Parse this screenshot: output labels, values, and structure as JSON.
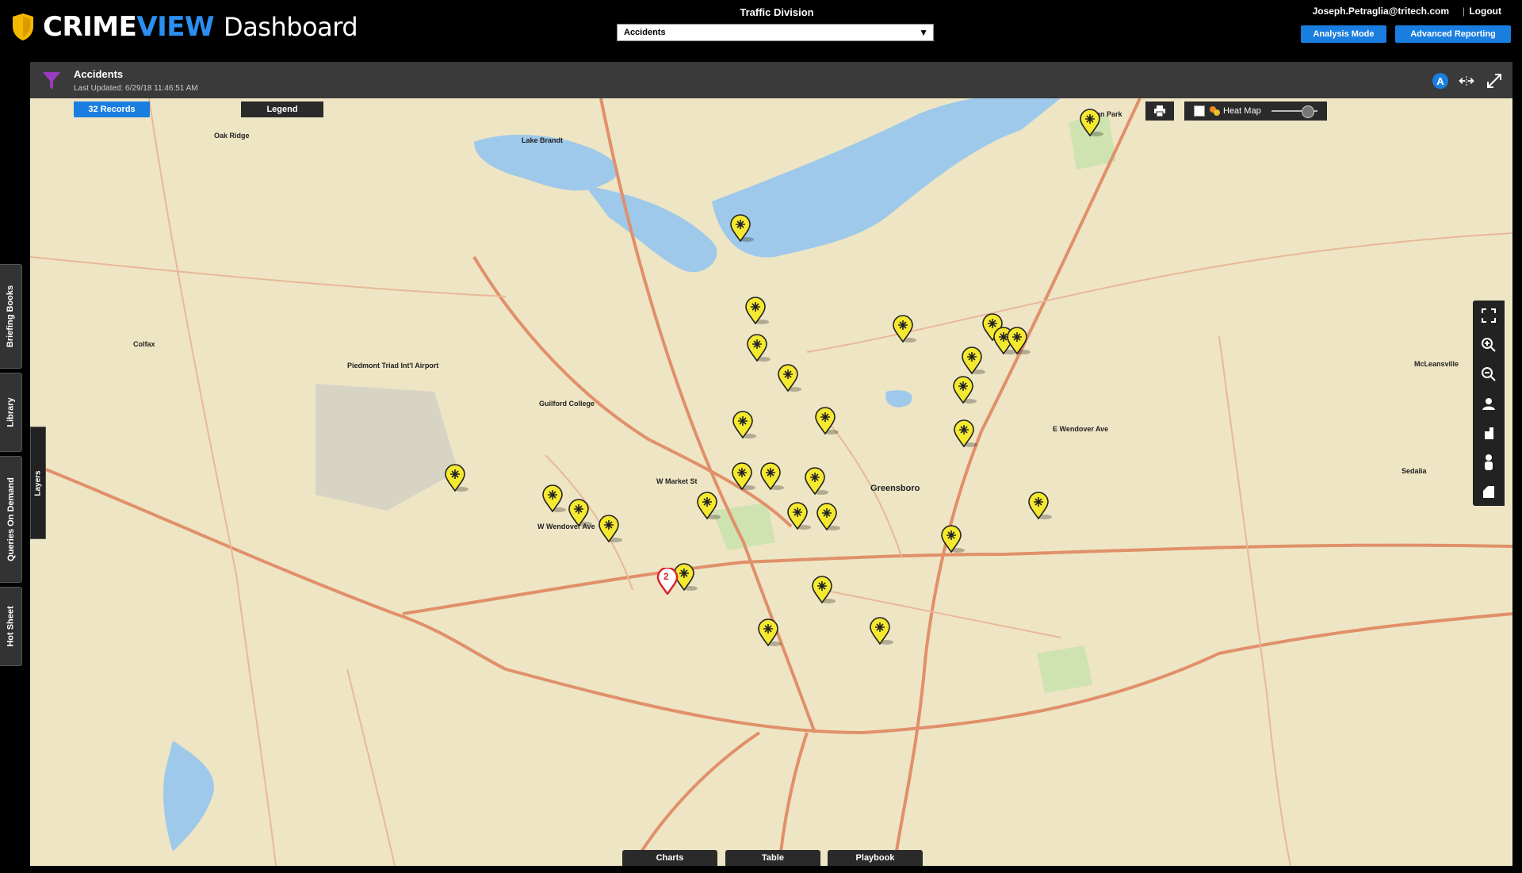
{
  "app": {
    "brand_crime": "CRIME",
    "brand_view": "VIEW",
    "brand_dashboard": "Dashboard"
  },
  "header": {
    "division": "Traffic Division",
    "selected_layer": "Accidents",
    "user": "Joseph.Petraglia@tritech.com",
    "separator": "|",
    "logout": "Logout",
    "analysis_mode": "Analysis Mode",
    "advanced_reporting": "Advanced Reporting"
  },
  "sidebar": {
    "tabs": [
      "Briefing Books",
      "Library",
      "Queries On Demand",
      "Hot Sheet"
    ],
    "layers": "Layers"
  },
  "panel": {
    "title": "Accidents",
    "updated": "Last Updated: 6/29/18 11:46:51 AM",
    "icon_letter": "A"
  },
  "map_controls": {
    "records": "32 Records",
    "legend": "Legend",
    "heat_map": "Heat Map",
    "bottom_tabs": [
      "Charts",
      "Table",
      "Playbook"
    ]
  },
  "map_labels": {
    "oak_ridge": "Oak Ridge",
    "colfax": "Colfax",
    "greensboro": "Greensboro",
    "mcleansville": "McLeansville",
    "sedalia": "Sedalia",
    "guilford_college": "Guilford College",
    "piedmont_triad": "Piedmont Triad Int'l Airport",
    "lake_brandt": "Lake Brandt",
    "w_market": "W Market St",
    "w_wendover": "W Wendover Ave",
    "e_wendover": "E Wendover Ave",
    "bryan_park": "Bryan Park",
    "cluster_count": "2"
  },
  "colors": {
    "accent": "#1a7ee0",
    "map_bg": "#eee5c4",
    "road": "#e0906a",
    "water": "#9ec9ea",
    "marker": "#f5e930"
  }
}
